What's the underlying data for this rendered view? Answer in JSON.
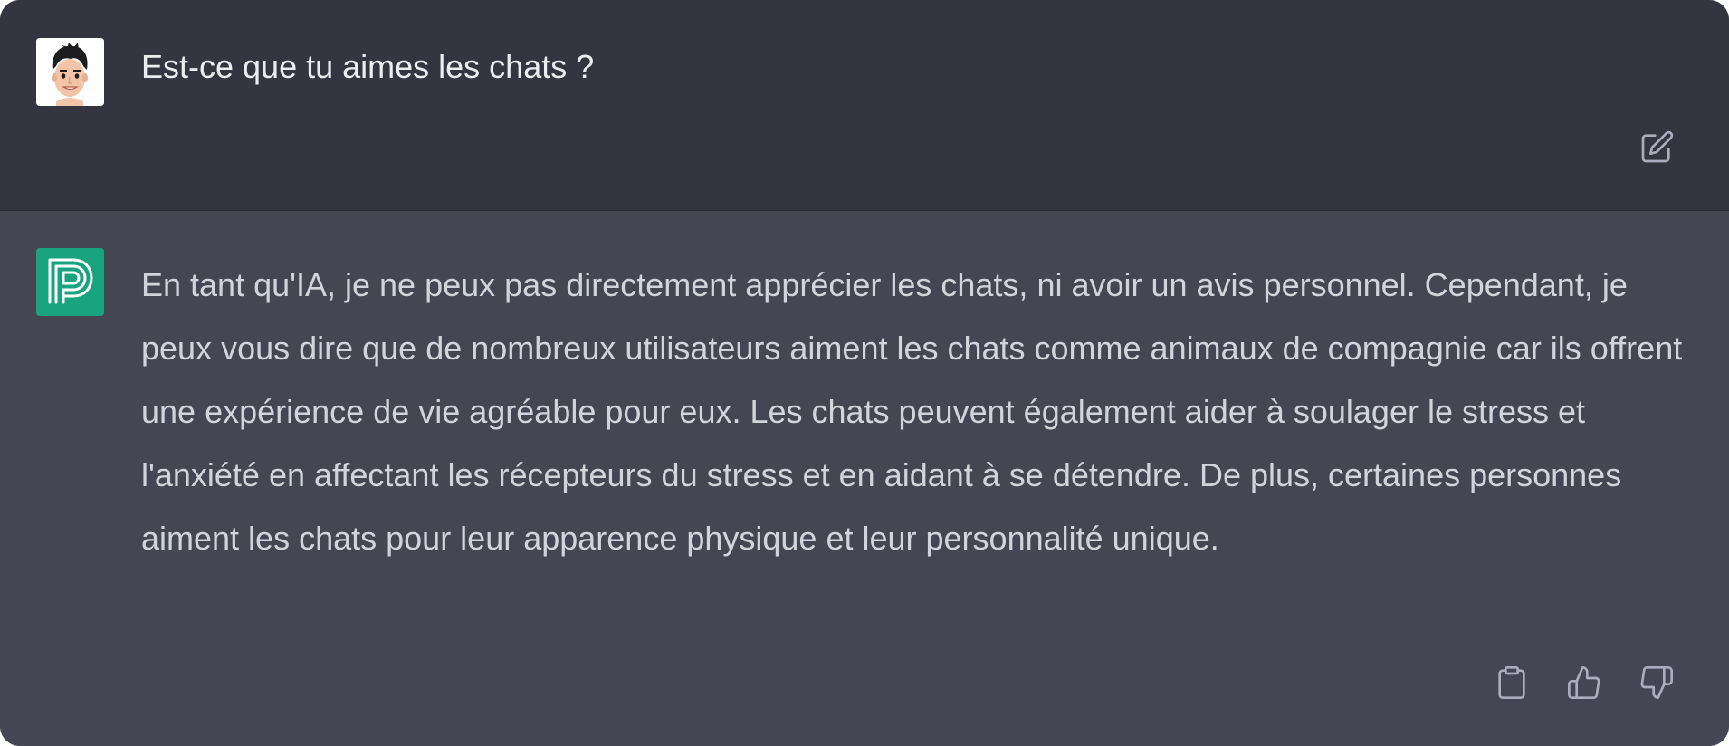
{
  "conversation": {
    "user_message": {
      "avatar_icon": "user-avatar-cartoon-face",
      "text": "Est-ce que tu aimes les chats ?",
      "edit_icon": "edit-icon"
    },
    "assistant_message": {
      "avatar_icon": "assistant-logo-icon",
      "avatar_color": "#19a37e",
      "text": "En tant qu'IA, je ne peux pas directement apprécier les chats, ni avoir un avis personnel. Cependant, je peux vous dire que de nombreux utilisateurs aiment les chats comme animaux de compagnie car ils offrent une expérience de vie agréable pour eux. Les chats peuvent également aider à soulager le stress et l'anxiété en affectant les récepteurs du stress et en aidant à se détendre. De plus, certaines personnes aiment les chats pour leur apparence physique et leur personnalité unique.",
      "actions": {
        "copy_icon": "clipboard-icon",
        "thumbs_up_icon": "thumbs-up-icon",
        "thumbs_down_icon": "thumbs-down-icon"
      }
    }
  },
  "colors": {
    "user_bg": "#343541",
    "assistant_bg": "#444654",
    "text": "#ececf1",
    "icon": "#acacbe"
  }
}
